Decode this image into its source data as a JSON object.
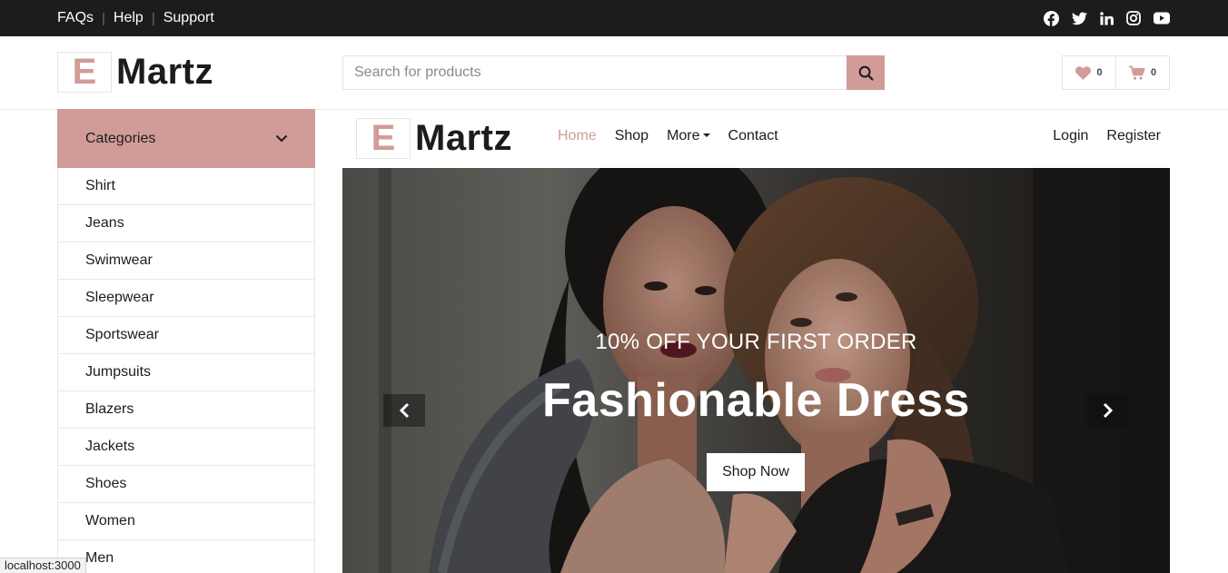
{
  "topbar": {
    "links": [
      "FAQs",
      "Help",
      "Support"
    ],
    "separator": "|",
    "social_icons": [
      "facebook-icon",
      "twitter-icon",
      "linkedin-icon",
      "instagram-icon",
      "youtube-icon"
    ]
  },
  "header": {
    "logo_letter": "E",
    "logo_word": "Martz",
    "search_placeholder": "Search for products",
    "wishlist_count": "0",
    "cart_count": "0"
  },
  "sidebar": {
    "title": "Categories",
    "items": [
      "Shirt",
      "Jeans",
      "Swimwear",
      "Sleepwear",
      "Sportswear",
      "Jumpsuits",
      "Blazers",
      "Jackets",
      "Shoes",
      "Women",
      "Men"
    ]
  },
  "navbar": {
    "logo_letter": "E",
    "logo_word": "Martz",
    "items": [
      "Home",
      "Shop",
      "More",
      "Contact"
    ],
    "active": "Home",
    "right_items": [
      "Login",
      "Register"
    ]
  },
  "hero": {
    "promo": "10% OFF YOUR FIRST ORDER",
    "headline": "Fashionable Dress",
    "cta": "Shop Now"
  },
  "status_url": "localhost:3000",
  "colors": {
    "accent": "#d19c97",
    "topbar": "#1c1c1c",
    "text": "#1c1c1c"
  }
}
